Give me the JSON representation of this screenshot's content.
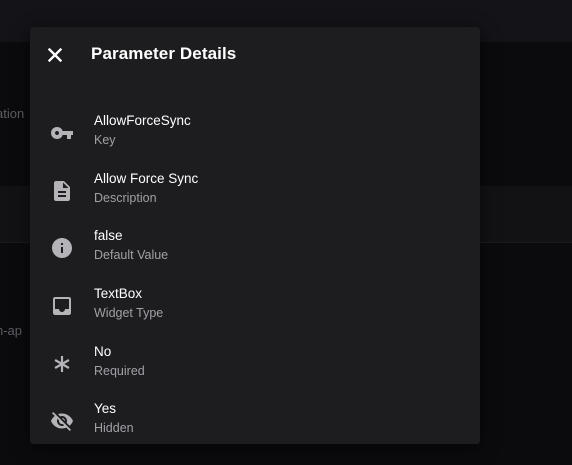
{
  "background": {
    "fragment_1": "ation",
    "fragment_2": "n-ap"
  },
  "dialog": {
    "title": "Parameter Details",
    "close_icon": "close-icon",
    "items": [
      {
        "icon": "key-icon",
        "value": "AllowForceSync",
        "label": "Key"
      },
      {
        "icon": "description-icon",
        "value": "Allow Force Sync",
        "label": "Description"
      },
      {
        "icon": "info-icon",
        "value": "false",
        "label": "Default Value"
      },
      {
        "icon": "inbox-icon",
        "value": "TextBox",
        "label": "Widget Type"
      },
      {
        "icon": "asterisk-icon",
        "value": "No",
        "label": "Required"
      },
      {
        "icon": "visibility-off-icon",
        "value": "Yes",
        "label": "Hidden"
      }
    ]
  },
  "colors": {
    "dialog_bg": "#1d1d20",
    "page_bg": "#0b0b0d",
    "primary_text": "#ffffff",
    "secondary_text": "#a0a0a6",
    "icon": "#b4b4b8"
  }
}
